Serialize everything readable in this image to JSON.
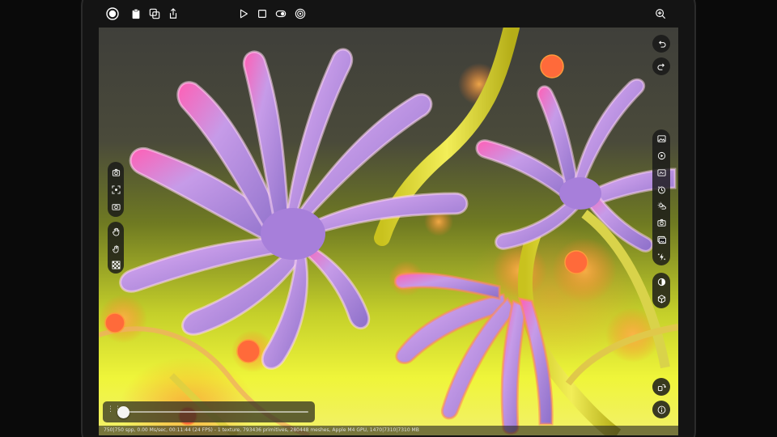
{
  "toolbar": {
    "left_icons": [
      "record-icon",
      "clipboard-icon",
      "duplicate-icon",
      "share-icon"
    ],
    "center_icons": [
      "play-icon",
      "stop-icon",
      "toggle-icon",
      "target-icon"
    ],
    "right_icons": [
      "zoom-icon"
    ]
  },
  "history": {
    "icons": [
      "undo-icon",
      "redo-icon"
    ]
  },
  "left_tools": {
    "group1": [
      "camera-orbit-icon",
      "focus-icon",
      "camera-icon"
    ],
    "group2": [
      "hand-icon",
      "pan-hand-icon",
      "checkerboard-icon"
    ]
  },
  "right_tools": {
    "group1": [
      "image-icon",
      "render-icon",
      "layers-icon",
      "history-icon",
      "weather-icon",
      "camera-icon",
      "gallery-icon",
      "effects-icon"
    ],
    "group2": [
      "material-icon",
      "cube-icon"
    ]
  },
  "bottom_right": {
    "icons": [
      "rotate-device-icon",
      "info-icon"
    ]
  },
  "timeline": {
    "progress": 0.0
  },
  "status": {
    "text": "750|750 spp, 0.00 Ms/sec, 00:11:44 (24 FPS) - 1 texture, 793436 primitives, 280448 meshes, Apple M4 GPU, 1470|7310|7310 MB"
  },
  "colors": {
    "accent": "#ffffff",
    "petal": "#b58be0",
    "petal_tip": "#ff5fb5",
    "stem": "#e9e23a",
    "background_top": "#3f3f3a",
    "background_bottom": "#f2f06a"
  }
}
